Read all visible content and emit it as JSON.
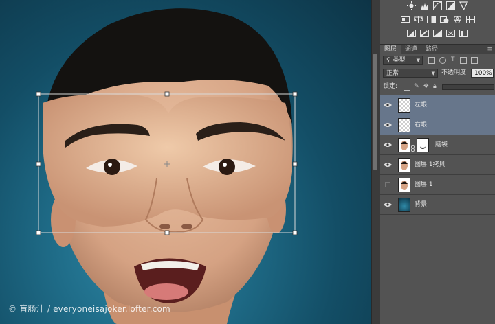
{
  "canvas": {
    "watermark": "© 盲肠汁 / everyoneisajoker.lofter.com"
  },
  "toolbar": {
    "row1_icons": [
      "brightness-icon",
      "levels-icon",
      "curves-icon",
      "exposure-icon",
      "gradient-triangle-icon"
    ],
    "row2_icons": [
      "vibrance-icon",
      "balance-icon",
      "bw-icon",
      "photo-filter-icon",
      "channel-mixer-icon",
      "color-lookup-icon"
    ],
    "row3_icons": [
      "invert-icon",
      "posterize-icon",
      "threshold-icon",
      "selective-color-icon",
      "gradient-map-icon"
    ]
  },
  "layers_panel": {
    "tabs": [
      {
        "label": "图层",
        "active": true
      },
      {
        "label": "通道",
        "active": false
      },
      {
        "label": "路径",
        "active": false
      }
    ],
    "filter_label": "类型",
    "blend_mode": "正常",
    "opacity_label": "不透明度:",
    "opacity_value": "100%",
    "lock_label": "锁定:",
    "layers": [
      {
        "name": "左眼",
        "selected": true,
        "visible": true,
        "thumb": "checker"
      },
      {
        "name": "右眼",
        "selected": true,
        "visible": true,
        "thumb": "checker"
      },
      {
        "name": "脑袋",
        "selected": false,
        "visible": true,
        "thumb": "face",
        "mask": true
      },
      {
        "name": "图层 1拷贝",
        "selected": false,
        "visible": true,
        "thumb": "face"
      },
      {
        "name": "图层 1",
        "selected": false,
        "visible": false,
        "thumb": "face"
      },
      {
        "name": "背景",
        "selected": false,
        "visible": true,
        "thumb": "bg"
      }
    ]
  },
  "colors": {
    "panel_bg": "#535353",
    "selected_layer": "#67768b",
    "canvas_bg": "#1f6c88"
  }
}
